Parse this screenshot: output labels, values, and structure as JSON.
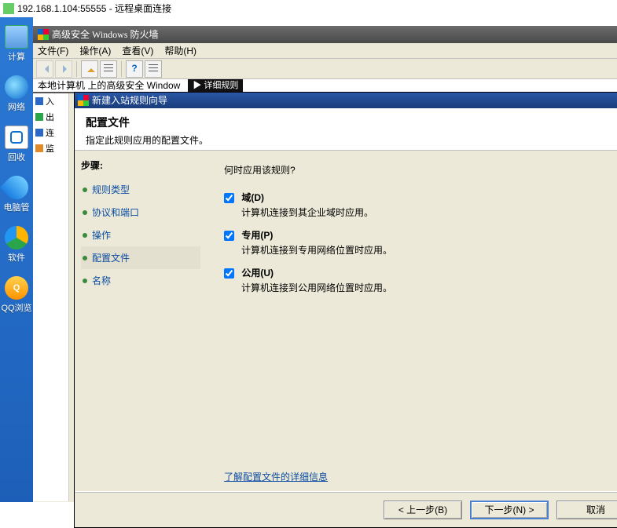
{
  "rdp": {
    "title": "192.168.1.104:55555 - 远程桌面连接"
  },
  "desktop": {
    "items": [
      {
        "label": "计算"
      },
      {
        "label": "网络"
      },
      {
        "label": "回收"
      },
      {
        "label": "电脑管"
      },
      {
        "label": "软件"
      },
      {
        "label": "QQ浏览"
      }
    ]
  },
  "firewall": {
    "title": "高级安全 Windows 防火墙",
    "menu": {
      "file": "文件(F)",
      "action": "操作(A)",
      "view": "查看(V)",
      "help": "帮助(H)"
    },
    "crumb": "本地计算机 上的高级安全 Window",
    "tab_label": "▶ 详细规则",
    "tree": {
      "inbound": "入",
      "outbound": "出",
      "conn": "连",
      "monitor": "监"
    }
  },
  "wizard": {
    "title": "新建入站规则向导",
    "header_title": "配置文件",
    "header_sub": "指定此规则应用的配置文件。",
    "steps_heading": "步骤:",
    "steps": {
      "rule_type": "规则类型",
      "protocol_ports": "协议和端口",
      "action": "操作",
      "profile": "配置文件",
      "name": "名称"
    },
    "content": {
      "prompt": "何时应用该规则?",
      "domain_label": "域(D)",
      "domain_desc": "计算机连接到其企业域时应用。",
      "private_label": "专用(P)",
      "private_desc": "计算机连接到专用网络位置时应用。",
      "public_label": "公用(U)",
      "public_desc": "计算机连接到公用网络位置时应用。",
      "learn_more": "了解配置文件的详细信息"
    },
    "footer": {
      "back": "< 上一步(B)",
      "next": "下一步(N) >",
      "cancel": "取消"
    }
  }
}
